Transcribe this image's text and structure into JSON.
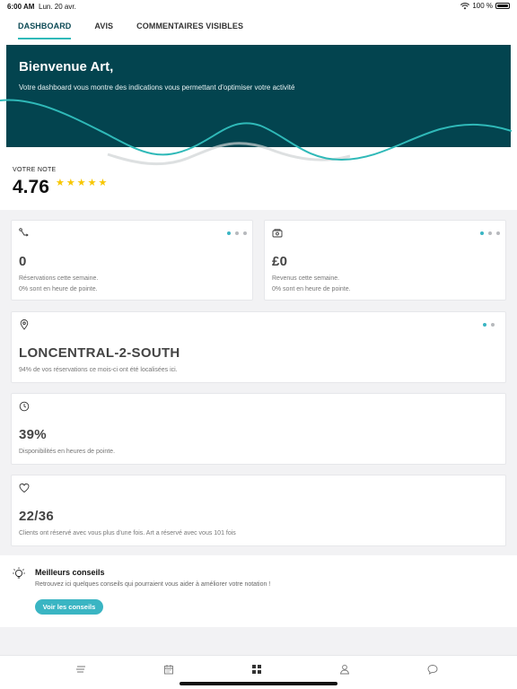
{
  "status": {
    "time": "6:00 AM",
    "date": "Lun. 20 avr.",
    "battery": "100 %"
  },
  "tabs": [
    {
      "label": "DASHBOARD",
      "active": true
    },
    {
      "label": "AVIS",
      "active": false
    },
    {
      "label": "COMMENTAIRES VISIBLES",
      "active": false
    }
  ],
  "banner": {
    "title": "Bienvenue Art,",
    "subtitle": "Votre dashboard vous montre des indications vous permettant d'optimiser votre activité",
    "color": "#03444f"
  },
  "rating": {
    "label": "VOTRE NOTE",
    "value": "4.76",
    "stars": 5
  },
  "cards": {
    "reservations": {
      "icon": "route-icon",
      "value": "0",
      "line1": "Réservations cette semaine.",
      "line2": "0% sont en heure de pointe."
    },
    "revenue": {
      "icon": "wallet-icon",
      "value": "£0",
      "line1": "Revenus cette semaine.",
      "line2": "0% sont en heure de pointe."
    },
    "location": {
      "icon": "location-pin-icon",
      "value": "LONCENTRAL-2-SOUTH",
      "line1": "94% de vos réservations ce mois-ci ont été localisées ici."
    },
    "availability": {
      "icon": "clock-icon",
      "value": "39%",
      "line1": "Disponibilités en heures de pointe."
    },
    "clients": {
      "icon": "heart-icon",
      "value": "22/36",
      "line1": "Clients ont réservé avec vous plus d'une fois. Art a réservé avec vous 101 fois"
    }
  },
  "tips": {
    "title": "Meilleurs conseils",
    "description": "Retrouvez ici quelques conseils qui pourraient vous aider à améliorer votre notation !",
    "button": "Voir les conseils"
  },
  "nav": [
    "list-icon",
    "calendar-icon",
    "dashboard-grid-icon",
    "profile-icon",
    "chat-icon"
  ],
  "colors": {
    "accent": "#3ab5c3",
    "star": "#f7c600",
    "dark": "#03444f"
  }
}
